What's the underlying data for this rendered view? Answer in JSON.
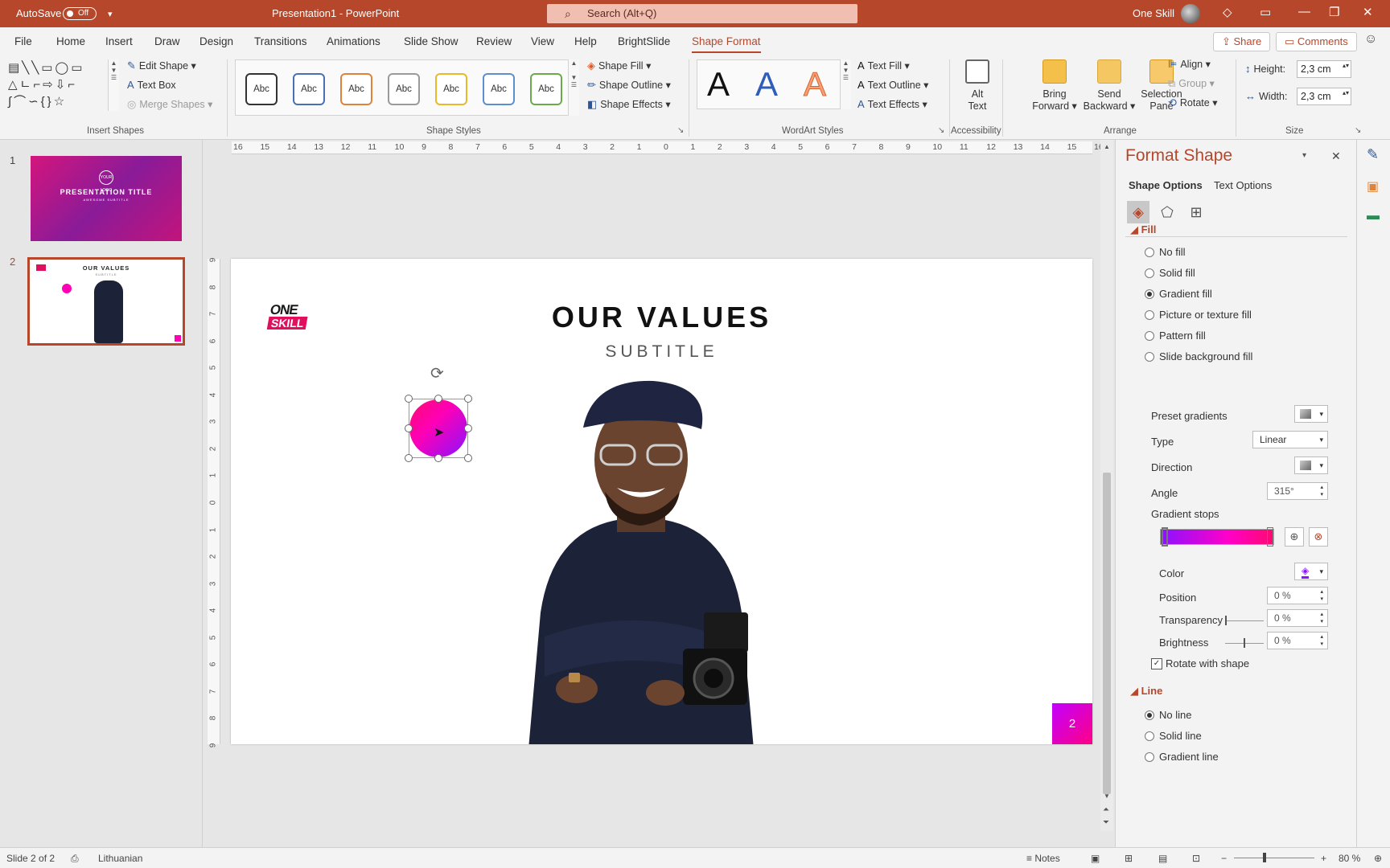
{
  "titlebar": {
    "autosave_label": "AutoSave",
    "autosave_state": "Off",
    "document_title": "Presentation1  -  PowerPoint",
    "search_placeholder": "Search (Alt+Q)",
    "user_name": "One Skill"
  },
  "menu": {
    "items": [
      "File",
      "Home",
      "Insert",
      "Draw",
      "Design",
      "Transitions",
      "Animations",
      "Slide Show",
      "Review",
      "View",
      "Help",
      "BrightSlide",
      "Shape Format"
    ],
    "active": "Shape Format",
    "share_label": "Share",
    "comments_label": "Comments"
  },
  "ribbon": {
    "insert_shapes": {
      "label": "Insert Shapes",
      "edit_shape": "Edit Shape",
      "text_box": "Text Box",
      "merge_shapes": "Merge Shapes"
    },
    "shape_styles": {
      "label": "Shape Styles",
      "swatches": [
        "Abc",
        "Abc",
        "Abc",
        "Abc",
        "Abc",
        "Abc",
        "Abc"
      ],
      "swatch_colors": [
        "#333333",
        "#4a6fb5",
        "#e0833a",
        "#9a9a9a",
        "#e8b92a",
        "#5b8fd0",
        "#6aaa4a"
      ],
      "shape_fill": "Shape Fill",
      "shape_outline": "Shape Outline",
      "shape_effects": "Shape Effects"
    },
    "wordart": {
      "label": "WordArt Styles",
      "samples": [
        "A",
        "A",
        "A"
      ],
      "text_fill": "Text Fill",
      "text_outline": "Text Outline",
      "text_effects": "Text Effects"
    },
    "accessibility": {
      "label": "Accessibility",
      "alt_text_line1": "Alt",
      "alt_text_line2": "Text"
    },
    "arrange": {
      "label": "Arrange",
      "bring_forward_1": "Bring",
      "bring_forward_2": "Forward",
      "send_backward_1": "Send",
      "send_backward_2": "Backward",
      "selection_pane_1": "Selection",
      "selection_pane_2": "Pane",
      "align": "Align",
      "group": "Group",
      "rotate": "Rotate"
    },
    "size": {
      "label": "Size",
      "height_label": "Height:",
      "height_value": "2,3 cm",
      "width_label": "Width:",
      "width_value": "2,3 cm"
    }
  },
  "thumbnails": {
    "slide1": {
      "number": "1",
      "logo_text": "YOUR LOGO",
      "title": "PRESENTATION TITLE",
      "subtitle": "AWESOME SUBTITLE"
    },
    "slide2": {
      "number": "2",
      "title": "OUR VALUES",
      "subtitle": "SUBTITLE"
    }
  },
  "ruler": {
    "horizontal": [
      "16",
      "15",
      "14",
      "13",
      "12",
      "11",
      "10",
      "9",
      "8",
      "7",
      "6",
      "5",
      "4",
      "3",
      "2",
      "1",
      "0",
      "1",
      "2",
      "3",
      "4",
      "5",
      "6",
      "7",
      "8",
      "9",
      "10",
      "11",
      "12",
      "13",
      "14",
      "15",
      "16"
    ],
    "vertical": [
      "9",
      "8",
      "7",
      "6",
      "5",
      "4",
      "3",
      "2",
      "1",
      "0",
      "1",
      "2",
      "3",
      "4",
      "5",
      "6",
      "7",
      "8",
      "9"
    ]
  },
  "slide": {
    "title": "OUR VALUES",
    "subtitle": "SUBTITLE",
    "logo_line1": "ONE",
    "logo_line2": "SKILL",
    "page_number": "2",
    "shape_gradient": [
      "#8a12ff",
      "#ff00b4",
      "#ff0a70"
    ]
  },
  "format_pane": {
    "title": "Format Shape",
    "tabs": [
      "Shape Options",
      "Text Options"
    ],
    "fill_section": "Fill",
    "fill_options": [
      "No fill",
      "Solid fill",
      "Gradient fill",
      "Picture or texture fill",
      "Pattern fill",
      "Slide background fill"
    ],
    "fill_selected": "Gradient fill",
    "preset_gradients_label": "Preset gradients",
    "type_label": "Type",
    "type_value": "Linear",
    "direction_label": "Direction",
    "angle_label": "Angle",
    "angle_value": "315°",
    "gradient_stops_label": "Gradient stops",
    "color_label": "Color",
    "position_label": "Position",
    "position_value": "0 %",
    "transparency_label": "Transparency",
    "transparency_value": "0 %",
    "brightness_label": "Brightness",
    "brightness_value": "0 %",
    "rotate_with_shape": "Rotate with shape",
    "line_section": "Line",
    "line_options": [
      "No line",
      "Solid line",
      "Gradient line"
    ],
    "line_selected": "No line"
  },
  "statusbar": {
    "slide_info": "Slide 2 of 2",
    "language": "Lithuanian",
    "notes": "Notes",
    "zoom": "80 %"
  },
  "colors": {
    "accent": "#b7472a",
    "gradient_start": "#8a12ff",
    "gradient_end": "#ff0a70"
  }
}
